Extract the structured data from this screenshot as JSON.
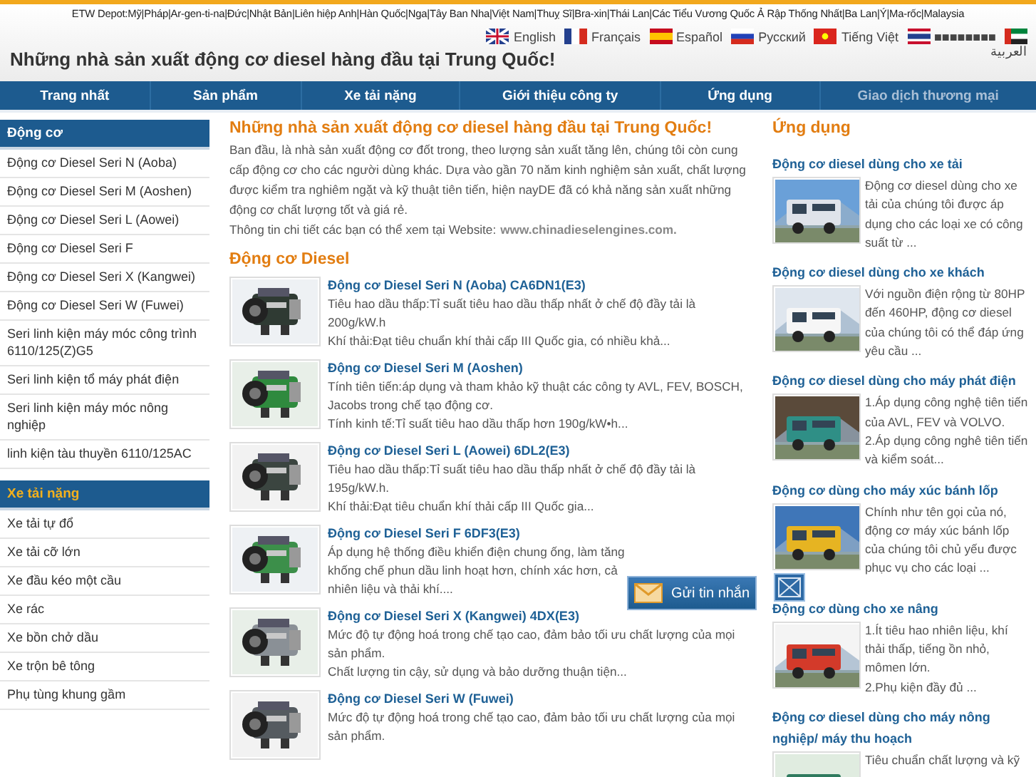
{
  "top_links": "ETW Depot:Mỹ|Pháp|Ar-gen-ti-na|Đức|Nhật Bản|Liên hiệp Anh|Hàn Quốc|Nga|Tây Ban Nha|Việt Nam|Thuỵ Sĩ|Bra-xin|Thái Lan|Các Tiểu Vương Quốc Ả Rập Thống Nhất|Ba Lan|Ý|Ma-rốc|Malaysia",
  "languages": [
    "English",
    "Français",
    "Español",
    "Русский",
    "Tiếng Việt",
    "■■■■■■■■",
    "العربية"
  ],
  "site_title": "Những nhà sản xuất động cơ diesel hàng đầu tại Trung Quốc!",
  "nav": [
    {
      "label": "Trang nhất",
      "selected": false
    },
    {
      "label": "Sản phẩm",
      "selected": false
    },
    {
      "label": "Xe tải nặng",
      "selected": false
    },
    {
      "label": "Giới thiệu công ty",
      "selected": false
    },
    {
      "label": "Ứng dụng",
      "selected": false
    },
    {
      "label": "Giao dịch thương mại",
      "selected": true
    }
  ],
  "sidebar": [
    {
      "title": "Động cơ",
      "selected": false,
      "items": [
        "Động cơ Diesel Seri N (Aoba)",
        "Động cơ Diesel Seri M (Aoshen)",
        "Động cơ Diesel Seri L (Aowei)",
        "Động cơ Diesel Seri F",
        "Động cơ Diesel Seri X (Kangwei)",
        "Động cơ Diesel Seri W (Fuwei)",
        "Seri linh kiện máy móc công trình 6110/125(Z)G5",
        "Seri linh kiện tổ máy phát điện",
        "Seri linh kiện máy móc nông nghiệp",
        "linh kiện tàu thuyền 6110/125AC"
      ]
    },
    {
      "title": "Xe tải nặng",
      "selected": true,
      "items": [
        "Xe tải tự đổ",
        "Xe tải cỡ lớn",
        "Xe đầu kéo một cầu",
        "Xe rác",
        "Xe bồn chở dầu",
        "Xe trộn bê tông",
        "Phụ tùng khung gầm"
      ]
    }
  ],
  "intro": {
    "heading": "Những nhà sản xuất động cơ diesel hàng đầu tại Trung Quốc!",
    "body": "Ban đầu, là nhà sản xuất động cơ đốt trong, theo lượng sản xuất tăng lên, chúng tôi còn cung cấp động cơ cho các người dùng khác. Dựa vào gần 70 năm kinh nghiệm sản xuất, chất lượng được kiểm tra nghiêm ngặt và kỹ thuật tiên tiến, hiện nayDE đã có khả năng sản xuất những động cơ chất lượng tốt và giá rẻ.",
    "website_label": "Thông tin chi tiết các bạn có thể xem tại Website:",
    "website_link": "www.chinadieselengines.com."
  },
  "products": {
    "heading": "Động cơ Diesel",
    "items": [
      {
        "title": "Động cơ Diesel Seri N (Aoba) CA6DN1(E3)",
        "lines": [
          "Tiêu hao dầu thấp:Tỉ suất tiêu hao dầu thấp nhất ở chế độ đầy tải là 200g/kW.h",
          "Khí thải:Đạt tiêu chuẩn khí thải cấp III Quốc gia, có nhiều khả..."
        ]
      },
      {
        "title": "Động cơ Diesel Seri M (Aoshen)",
        "lines": [
          "Tính tiên tiến:áp dụng và tham khảo kỹ thuật các công ty AVL, FEV, BOSCH, Jacobs trong chế tạo động cơ.",
          "Tính kinh tế:Tỉ suất tiêu hao dầu thấp hơn 190g/kW•h..."
        ]
      },
      {
        "title": "Động cơ Diesel Seri L (Aowei) 6DL2(E3)",
        "lines": [
          "Tiêu hao dầu thấp:Tỉ suất tiêu hao dầu thấp nhất ở chế độ đầy tải là 195g/kW.h.",
          "Khí thải:Đạt tiêu chuẩn khí thải cấp III Quốc gia..."
        ]
      },
      {
        "title": "Động cơ Diesel Seri F 6DF3(E3)",
        "lines": [
          "Áp dụng hệ thống điều khiển điện chung ống, làm tăng",
          "khống chế phun dầu linh hoạt hơn, chính xác hơn, cả",
          "nhiên liệu và thải khí...."
        ]
      },
      {
        "title": "Động cơ Diesel Seri X (Kangwei) 4DX(E3)",
        "lines": [
          "Mức độ tự động hoá trong chế tạo cao, đảm bảo tối ưu chất lượng của mọi sản phẩm.",
          "Chất lượng tin cậy, sử dụng và bảo dưỡng thuận tiện..."
        ]
      },
      {
        "title": "Động cơ Diesel Seri W (Fuwei)",
        "lines": [
          "Mức độ tự động hoá trong chế tạo cao, đảm bảo tối ưu chất lượng của mọi sản phẩm."
        ]
      }
    ]
  },
  "applications": {
    "heading": "Ứng dụng",
    "items": [
      {
        "title": "Động cơ diesel dùng cho xe tải",
        "text": "Động cơ diesel dùng cho xe tải của chúng tôi được áp dụng cho các loại xe có công suất từ ..."
      },
      {
        "title": "Động cơ diesel dùng cho xe khách",
        "text": "Với nguồn điện rộng từ 80HP đến 460HP, động cơ diesel của chúng tôi có thể đáp ứng yêu cầu ..."
      },
      {
        "title": "Động cơ diesel dùng cho máy phát điện",
        "text": "1.Áp dụng công nghệ tiên tiến của AVL, FEV và VOLVO.\n2.Áp dụng công nghê tiên tiến và kiểm soát..."
      },
      {
        "title": "Động cơ dùng cho máy xúc bánh lốp",
        "text": "Chính như tên gọi của nó, động cơ máy xúc bánh lốp của chúng tôi chủ yếu được phục vụ cho các loại ..."
      },
      {
        "title": "Động cơ dùng cho xe nâng",
        "text": "1.Ít tiêu hao nhiên liệu, khí thải thấp, tiếng ồn nhỏ, mômen lớn.\n2.Phụ kiện đầy đủ ..."
      },
      {
        "title": "Động cơ diesel dùng cho máy nông nghiệp/ máy thu hoạch",
        "text": "Tiêu chuẩn chất lượng và kỹ"
      }
    ]
  },
  "message_widget": {
    "label": "Gửi tin nhắn"
  }
}
